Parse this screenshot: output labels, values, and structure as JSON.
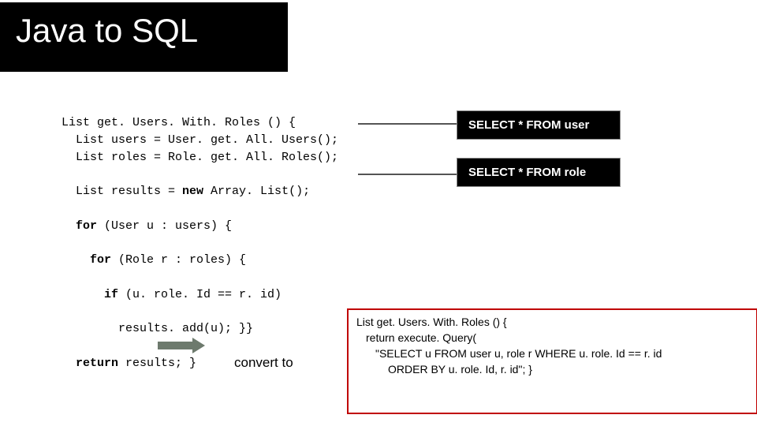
{
  "title": "Java to SQL",
  "code": {
    "l1": "List get. Users. With. Roles () {",
    "l2": "  List users = User. get. All. Users();",
    "l3": "  List roles = Role. get. All. Roles();",
    "l4": "  List results = ",
    "l4kw": "new",
    "l4b": " Array. List();",
    "l5kw": "  for",
    "l5": " (User u : users) {",
    "l6kw": "    for",
    "l6": " (Role r : roles) {",
    "l7kw": "      if",
    "l7": " (u. role. Id == r. id)",
    "l8": "        results. add(u); }}",
    "l9kw": "  return",
    "l9": " results; }"
  },
  "sql1": "SELECT * FROM user",
  "sql2": "SELECT * FROM role",
  "convert": "convert to",
  "red": {
    "r1": "List get. Users. With. Roles () {",
    "r2": "return execute. Query(",
    "r3": "\"SELECT   u FROM user u, role r   WHERE    u. role. Id == r. id",
    "r4": "ORDER BY u. role. Id, r. id\"; }"
  }
}
